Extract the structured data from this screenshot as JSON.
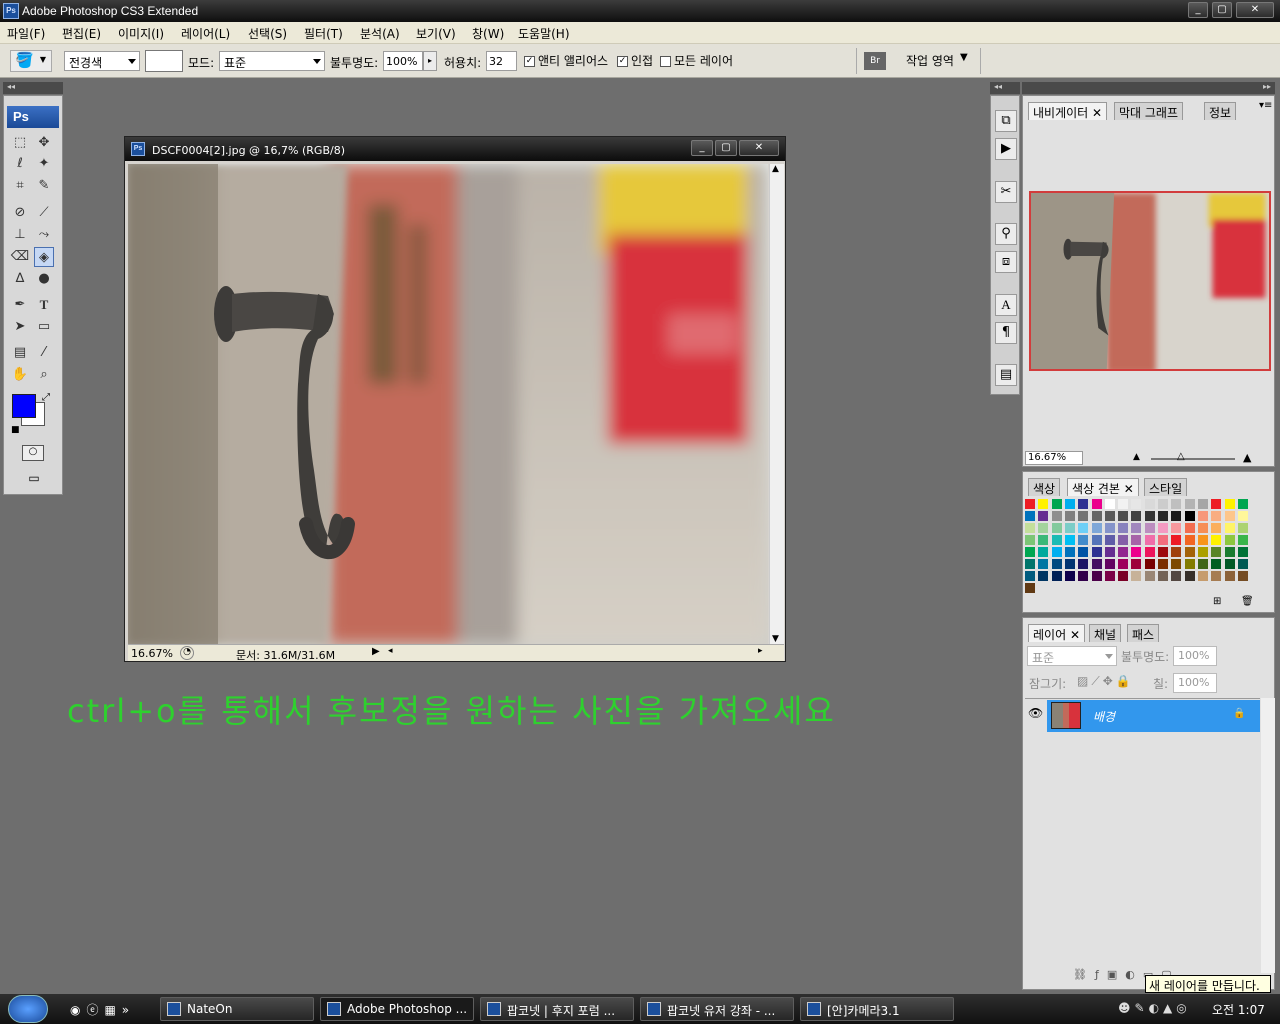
{
  "app": {
    "title": "Adobe Photoshop CS3 Extended",
    "icon": "Ps"
  },
  "menu": [
    "파일(F)",
    "편집(E)",
    "이미지(I)",
    "레이어(L)",
    "선택(S)",
    "필터(T)",
    "분석(A)",
    "보기(V)",
    "창(W)",
    "도움말(H)"
  ],
  "options": {
    "fill_source": "전경색",
    "mode_label": "모드:",
    "mode_value": "표준",
    "opacity_label": "불투명도:",
    "opacity_value": "100%",
    "tolerance_label": "허용치:",
    "tolerance_value": "32",
    "antialias_label": "앤티 앨리어스",
    "antialias_checked": true,
    "contiguous_label": "인접",
    "contiguous_checked": true,
    "all_layers_label": "모든 레이어",
    "all_layers_checked": false,
    "workspace_label": "작업 영역"
  },
  "document": {
    "title": "DSCF0004[2].jpg @ 16,7% (RGB/8)",
    "zoom": "16.67%",
    "doc_size": "문서: 31.6M/31.6M"
  },
  "caption": "ctrl+o를 통해서 후보정을 원하는 사진을 가져오세요",
  "navigator": {
    "tabs": [
      "내비게이터",
      "막대 그래프",
      "정보"
    ],
    "zoom": "16.67%"
  },
  "swatch_panel": {
    "tabs": [
      "색상",
      "색상 견본",
      "스타일"
    ],
    "swatch_colors": [
      "#ed1c24",
      "#fff200",
      "#00a651",
      "#00aeef",
      "#2e3192",
      "#ec008c",
      "#ffffff",
      "#f2f2f2",
      "#e6e6e6",
      "#d9d9d9",
      "#cccccc",
      "#bfbfbf",
      "#b3b3b3",
      "#a6a6a6",
      "#ed1c24",
      "#fff200",
      "#00a651",
      "#0072bc",
      "#662d91",
      "#8e8e8e",
      "#7f7f7f",
      "#737373",
      "#666666",
      "#595959",
      "#4d4d4d",
      "#404040",
      "#333333",
      "#262626",
      "#1a1a1a",
      "#000000",
      "#f7977a",
      "#f9ad81",
      "#fdc68a",
      "#fff79a",
      "#c4df9b",
      "#a3d39c",
      "#82ca9d",
      "#7bcdc8",
      "#6ecff6",
      "#7ea7d8",
      "#8493ca",
      "#8882be",
      "#a187be",
      "#bc8dbf",
      "#f49ac2",
      "#f6989d",
      "#f26c4f",
      "#f68e55",
      "#fbaf5d",
      "#fff467",
      "#acd372",
      "#7cc576",
      "#3bb878",
      "#1abbb4",
      "#00bff3",
      "#438ccb",
      "#5574b9",
      "#605ca8",
      "#855fa8",
      "#a763a8",
      "#f06eaa",
      "#f26d7d",
      "#ed1c24",
      "#f26522",
      "#f7941d",
      "#fff200",
      "#8dc73f",
      "#39b54a",
      "#00a651",
      "#00a99d",
      "#00aeef",
      "#0072bc",
      "#0054a6",
      "#2e3192",
      "#662d91",
      "#92278f",
      "#ec008c",
      "#ed145b",
      "#9e0b0f",
      "#a0410d",
      "#a36209",
      "#aba000",
      "#598527",
      "#1a7b30",
      "#007236",
      "#00746b",
      "#0076a3",
      "#004a80",
      "#003471",
      "#1b1464",
      "#440e62",
      "#630460",
      "#9e005d",
      "#9e0039",
      "#790000",
      "#7b2e00",
      "#7d4900",
      "#827b00",
      "#406618",
      "#005e20",
      "#005826",
      "#005952",
      "#005b7f",
      "#003663",
      "#002157",
      "#0d004c",
      "#32004b",
      "#4b0049",
      "#7b0046",
      "#7a0026",
      "#c7b299",
      "#998675",
      "#736357",
      "#534741",
      "#37302a",
      "#c69c6d",
      "#a67c52",
      "#8c6239",
      "#754c24",
      "#603913"
    ],
    "cols": 17
  },
  "layers_panel": {
    "tabs": [
      "레이어",
      "채널",
      "패스"
    ],
    "blend": "표준",
    "opacity_label": "불투명도:",
    "opacity_value": "100%",
    "lock_label": "잠그기:",
    "fill_label": "칠:",
    "fill_value": "100%",
    "layer_name": "배경",
    "tooltip": "새 레이어를 만듭니다."
  },
  "taskbar": {
    "items": [
      "NateOn",
      "Adobe Photoshop ...",
      "팝코넷 | 후지 포럼 ...",
      "팝코넷 유저 강좌 - ...",
      "[안]카메라3.1"
    ],
    "clock": "오전 1:07"
  },
  "colors": {
    "foreground": "#0000ff",
    "background": "#ffffff",
    "caption": "#2ed12e",
    "layer_selected": "#3297ed"
  }
}
